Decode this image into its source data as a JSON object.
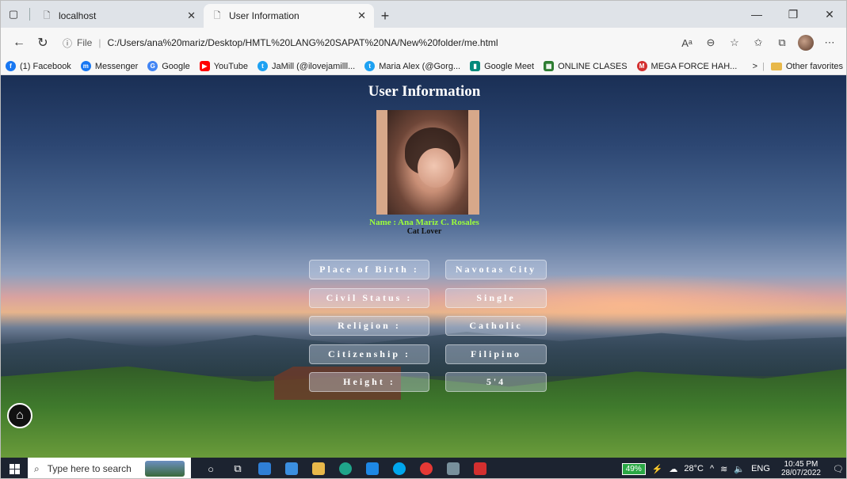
{
  "browser": {
    "tabs": [
      {
        "title": "localhost",
        "active": false
      },
      {
        "title": "User Information",
        "active": true
      }
    ],
    "address": {
      "file_label": "File",
      "url": "C:/Users/ana%20mariz/Desktop/HMTL%20LANG%20SAPAT%20NA/New%20folder/me.html"
    },
    "favorites": [
      {
        "label": "(1) Facebook",
        "color": "#1877f2"
      },
      {
        "label": "Messenger",
        "color": "#1877f2"
      },
      {
        "label": "Google",
        "color": "#4285f4"
      },
      {
        "label": "YouTube",
        "color": "#ff0000"
      },
      {
        "label": "JaMill (@ilovejamilll...",
        "color": "#1da1f2"
      },
      {
        "label": "Maria Alex (@Gorg...",
        "color": "#1da1f2"
      },
      {
        "label": "Google Meet",
        "color": "#00897b"
      },
      {
        "label": "ONLINE CLASES",
        "color": "#2e7d32"
      },
      {
        "label": "MEGA FORCE HAH...",
        "color": "#d32f2f"
      }
    ],
    "other_favorites": "Other favorites"
  },
  "page": {
    "title": "User Information",
    "name": "Name : Ana Mariz C. Rosales",
    "tagline": "Cat Lover",
    "info": [
      {
        "label": "Place of Birth :",
        "value": "Navotas City"
      },
      {
        "label": "Civil Status :",
        "value": "Single"
      },
      {
        "label": "Religion :",
        "value": "Catholic"
      },
      {
        "label": "Citizenship :",
        "value": "Filipino"
      },
      {
        "label": "Height :",
        "value": "5'4"
      }
    ]
  },
  "taskbar": {
    "search_placeholder": "Type here to search",
    "battery": "49%",
    "weather": "28°C",
    "lang": "ENG",
    "time": "10:45 PM",
    "date": "28/07/2022"
  },
  "colors": {
    "name_color": "#9dff3a",
    "info_box": "rgba(215,225,245,0.35)"
  }
}
